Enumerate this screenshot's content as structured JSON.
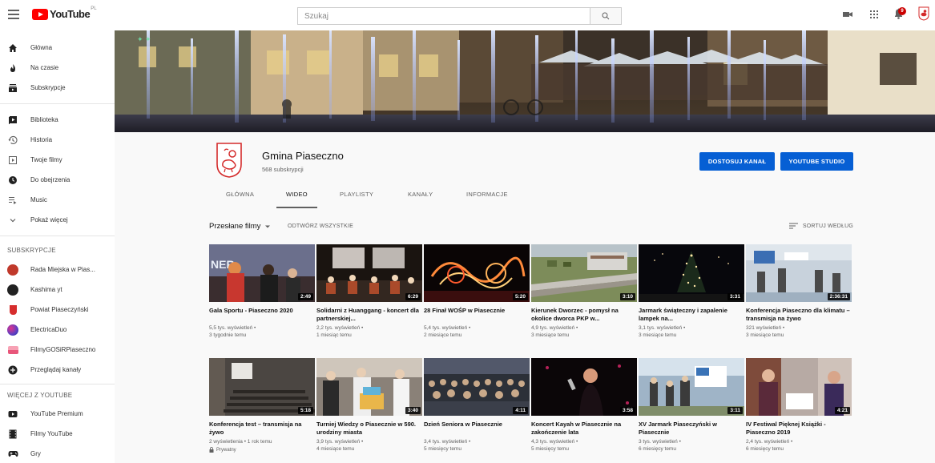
{
  "header": {
    "logo_text": "YouTube",
    "logo_country": "PL",
    "search_placeholder": "Szukaj",
    "notification_count": "9"
  },
  "sidebar": {
    "main": [
      {
        "label": "Główna",
        "icon": "home-icon"
      },
      {
        "label": "Na czasie",
        "icon": "trending-icon"
      },
      {
        "label": "Subskrypcje",
        "icon": "subscriptions-icon"
      }
    ],
    "library": [
      {
        "label": "Biblioteka",
        "icon": "library-icon"
      },
      {
        "label": "Historia",
        "icon": "history-icon"
      },
      {
        "label": "Twoje filmy",
        "icon": "your-videos-icon"
      },
      {
        "label": "Do obejrzenia",
        "icon": "watch-later-icon"
      },
      {
        "label": "Music",
        "icon": "playlist-icon"
      },
      {
        "label": "Pokaż więcej",
        "icon": "chevron-down-icon"
      }
    ],
    "subscriptions_title": "SUBSKRYPCJE",
    "subscriptions": [
      {
        "label": "Rada Miejska w Pias...",
        "color": "#c0392b"
      },
      {
        "label": "Kashima yt",
        "color": "#222222"
      },
      {
        "label": "Powiat Piaseczyński",
        "color": "#d62d2d"
      },
      {
        "label": "ElectricaDuo",
        "color": "#5b3fc4"
      },
      {
        "label": "FilmyGOSiRPiaseczno",
        "color": "#e8567a"
      },
      {
        "label": "Przeglądaj kanały",
        "color": "#606060"
      }
    ],
    "more_title": "WIĘCEJ Z YOUTUBE",
    "more": [
      {
        "label": "YouTube Premium",
        "icon": "youtube-premium-icon"
      },
      {
        "label": "Filmy YouTube",
        "icon": "movies-icon"
      },
      {
        "label": "Gry",
        "icon": "gaming-icon"
      }
    ]
  },
  "channel": {
    "name": "Gmina Piaseczno",
    "subscribers": "568 subskrypcji",
    "customize_label": "DOSTOSUJ KANAŁ",
    "studio_label": "YOUTUBE STUDIO",
    "tabs": [
      "GŁÓWNA",
      "WIDEO",
      "PLAYLISTY",
      "KANAŁY",
      "INFORMACJE"
    ],
    "active_tab": "WIDEO"
  },
  "content": {
    "uploads_label": "Przesłane filmy",
    "play_all_label": "ODTWÓRZ WSZYSTKIE",
    "sort_label": "SORTUJ WEDŁUG"
  },
  "videos": [
    {
      "title": "Gala Sportu - Piaseczno 2020",
      "views": "5,5 tys. wyświetleń •",
      "age": "3 tygodnie temu",
      "duration": "2:49"
    },
    {
      "title": "Solidarni z Huanggang - koncert dla partnerskiej...",
      "views": "2,2 tys. wyświetleń •",
      "age": "1 miesiąc temu",
      "duration": "6:29"
    },
    {
      "title": "28 Finał WOŚP w Piasecznie",
      "views": "5,4 tys. wyświetleń •",
      "age": "2 miesiące temu",
      "duration": "5:20"
    },
    {
      "title": "Kierunek Dworzec - pomysł na okolice dworca PKP w...",
      "views": "4,9 tys. wyświetleń •",
      "age": "3 miesiące temu",
      "duration": "3:10"
    },
    {
      "title": "Jarmark świąteczny i zapalenie lampek na...",
      "views": "3,1 tys. wyświetleń •",
      "age": "3 miesiące temu",
      "duration": "3:31"
    },
    {
      "title": "Konferencja Piaseczno dla klimatu – transmisja na żywo",
      "views": "321 wyświetleń •",
      "age": "3 miesiące temu",
      "duration": "2:36:31"
    },
    {
      "title": "Konferencja test – transmisja na żywo",
      "views": "2 wyświetlenia • 1 rok temu",
      "age": "",
      "duration": "5:18",
      "badge": "Prywatny"
    },
    {
      "title": "Turniej Wiedzy o Piasecznie w 590. urodziny miasta",
      "views": "3,9 tys. wyświetleń •",
      "age": "4 miesiące temu",
      "duration": "3:40"
    },
    {
      "title": "Dzień Seniora w Piasecznie",
      "views": "3,4 tys. wyświetleń •",
      "age": "5 miesięcy temu",
      "duration": "4:11"
    },
    {
      "title": "Koncert Kayah w Piasecznie na zakończenie lata",
      "views": "4,3 tys. wyświetleń •",
      "age": "5 miesięcy temu",
      "duration": "3:58"
    },
    {
      "title": "XV Jarmark Piaseczyński w Piasecznie",
      "views": "3 tys. wyświetleń •",
      "age": "6 miesięcy temu",
      "duration": "3:11"
    },
    {
      "title": "IV Festiwal Pięknej Książki - Piaseczno 2019",
      "views": "2,4 tys. wyświetleń •",
      "age": "6 miesięcy temu",
      "duration": "4:21"
    }
  ]
}
